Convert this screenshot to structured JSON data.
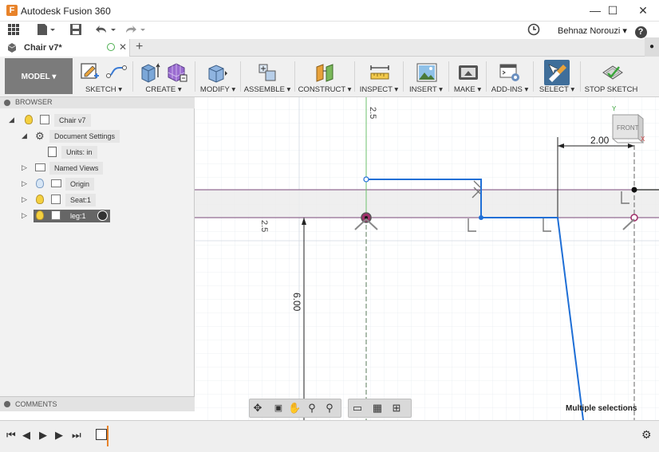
{
  "window": {
    "title": "Autodesk Fusion 360",
    "minimize": "—",
    "maximize": "☐",
    "close": "✕"
  },
  "quick_access": {
    "user_name": "Behnaz Norouzi ▾",
    "help": "?"
  },
  "document_tab": {
    "label": "Chair v7*",
    "close": "✕",
    "new_tab": "+"
  },
  "ribbon": {
    "workspace": "MODEL ▾",
    "groups": {
      "sketch": "SKETCH ▾",
      "create": "CREATE ▾",
      "modify": "MODIFY ▾",
      "assemble": "ASSEMBLE ▾",
      "construct": "CONSTRUCT ▾",
      "inspect": "INSPECT ▾",
      "insert": "INSERT ▾",
      "make": "MAKE ▾",
      "addins": "ADD-INS ▾",
      "select": "SELECT ▾",
      "stop_sketch": "STOP SKETCH"
    }
  },
  "browser": {
    "title": "BROWSER",
    "items": {
      "root": "Chair v7",
      "doc_settings": "Document Settings",
      "units": "Units: in",
      "named_views": "Named Views",
      "origin": "Origin",
      "seat": "Seat:1",
      "leg": "leg:1"
    }
  },
  "comments": {
    "title": "COMMENTS"
  },
  "canvas": {
    "viewcube": "FRONT",
    "viewcube_x": "X",
    "viewcube_y": "Y",
    "dim_top": "2.00",
    "dim_vertical": "6.00",
    "grid_label_top": "2.5",
    "grid_label_left": "2.5"
  },
  "status": "Multiple selections",
  "colors": {
    "sketch_blue": "#1f6fd6",
    "purple_line": "#7a4a7a",
    "accent_orange": "#e8832a"
  }
}
